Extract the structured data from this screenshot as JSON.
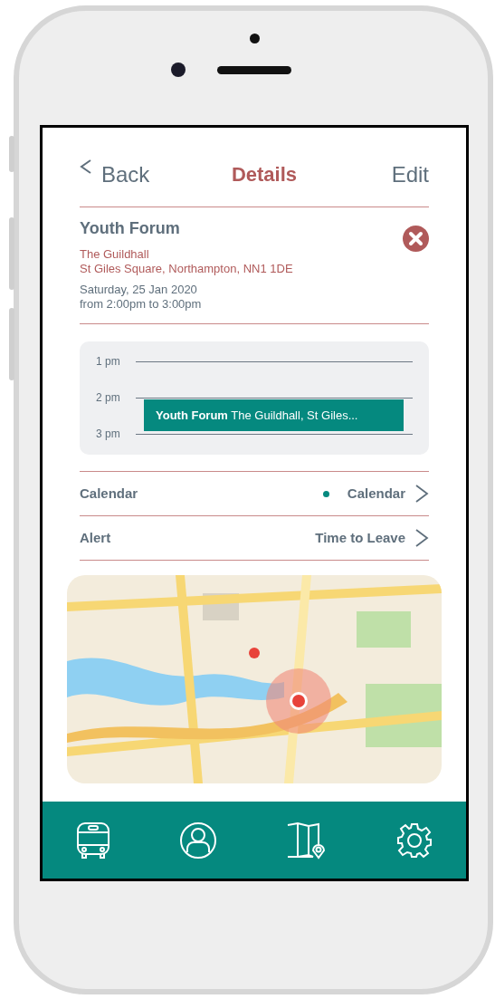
{
  "header": {
    "back_label": "Back",
    "title": "Details",
    "edit_label": "Edit"
  },
  "event": {
    "title": "Youth Forum",
    "venue": "The Guildhall",
    "address": "St Giles Square, Northampton, NN1 1DE",
    "date": "Saturday, 25 Jan 2020",
    "time": "from 2:00pm to 3:00pm"
  },
  "timeline": {
    "hours": [
      "1 pm",
      "2 pm",
      "3 pm"
    ],
    "event": "**Youth Forum** The Guildhall, St Giles..."
  },
  "settings": [
    {
      "label": "Calendar",
      "value": "Calendar",
      "color": "#05897f"
    },
    {
      "label": "Alert",
      "value": "Time to Leave"
    }
  ],
  "nav": [
    {
      "kind": "bus"
    },
    {
      "kind": "profile"
    },
    {
      "kind": "map"
    },
    {
      "kind": "settings"
    }
  ]
}
